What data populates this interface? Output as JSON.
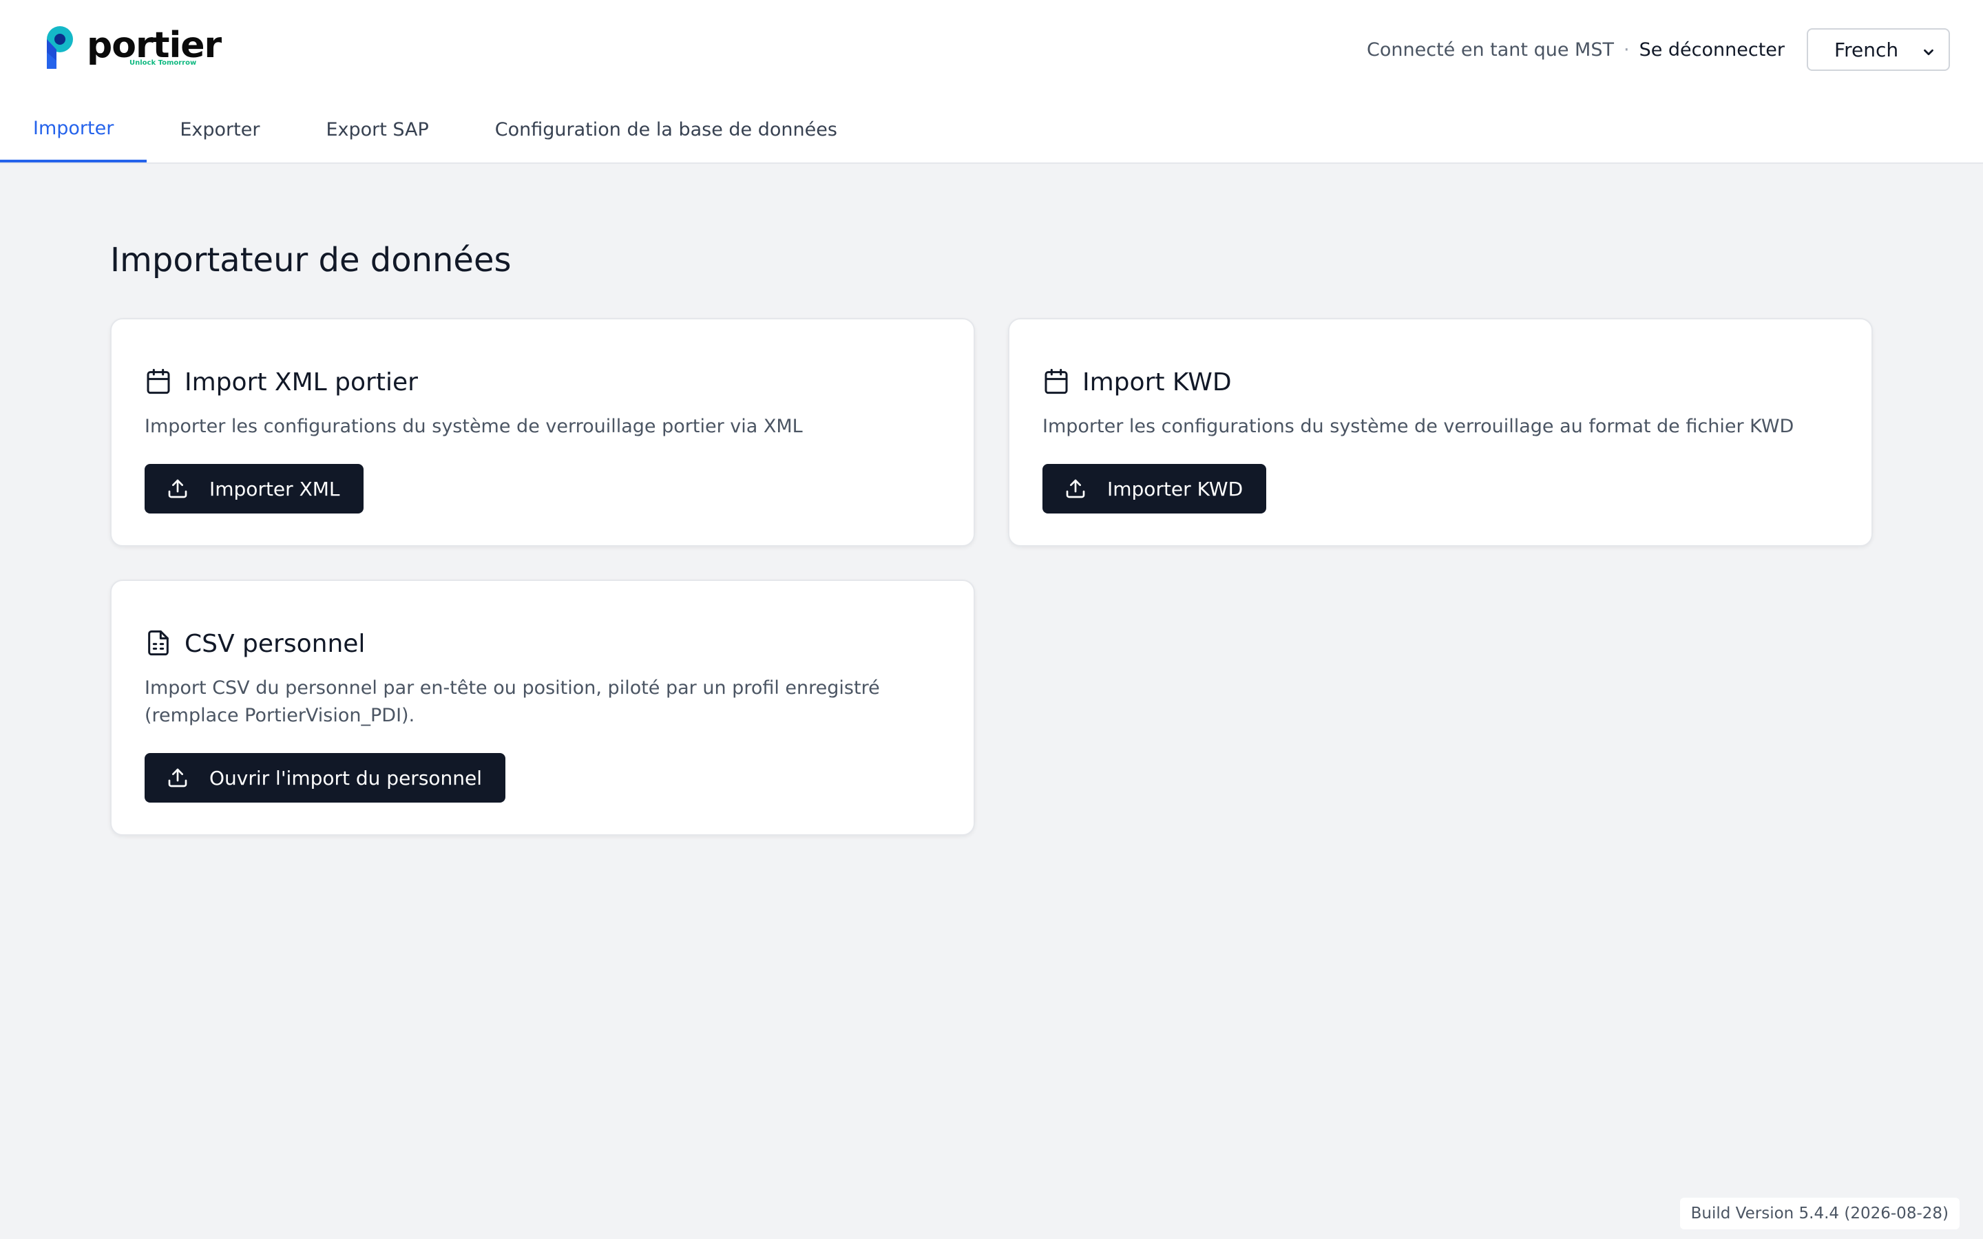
{
  "brand": {
    "name": "portier",
    "tagline": "Unlock Tomorrow"
  },
  "header": {
    "user_label": "Connecté en tant que MST",
    "separator": "·",
    "logout_label": "Se déconnecter",
    "language": "French"
  },
  "tabs": [
    {
      "label": "Importer",
      "active": true
    },
    {
      "label": "Exporter",
      "active": false
    },
    {
      "label": "Export SAP",
      "active": false
    },
    {
      "label": "Configuration de la base de données",
      "active": false
    }
  ],
  "main": {
    "title": "Importateur de données",
    "cards": [
      {
        "icon": "calendar-icon",
        "title": "Import XML portier",
        "description": "Importer les configurations du système de verrouillage portier via XML",
        "button_label": "Importer XML",
        "button_icon": "upload-icon"
      },
      {
        "icon": "calendar-icon",
        "title": "Import KWD",
        "description": "Importer les configurations du système de verrouillage au format de fichier KWD",
        "button_label": "Importer KWD",
        "button_icon": "upload-icon"
      },
      {
        "icon": "file-spreadsheet-icon",
        "title": "CSV personnel",
        "description": "Import CSV du personnel par en-tête ou position, piloté par un profil enregistré (remplace PortierVision_PDI).",
        "button_label": "Ouvrir l'import du personnel",
        "button_icon": "upload-icon"
      }
    ]
  },
  "footer": {
    "build_version": "Build Version 5.4.4 (2026-08-28)"
  },
  "colors": {
    "accent": "#2563eb",
    "button_bg": "#111827",
    "page_bg": "#f2f3f5",
    "logo_teal": "#14b8c8",
    "logo_blue": "#1d4ed8",
    "tagline_green": "#10b981"
  }
}
